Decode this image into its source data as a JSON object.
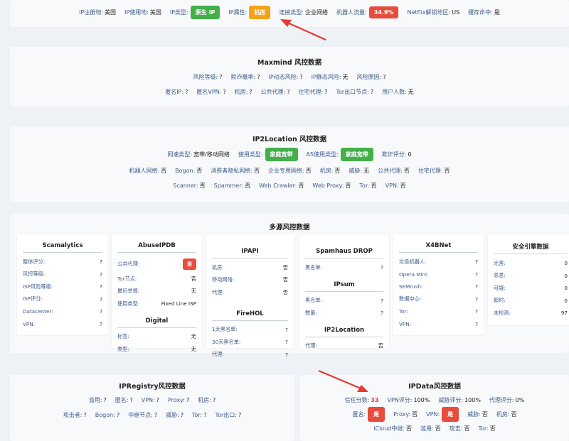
{
  "top": {
    "items": [
      {
        "k": "IP注册地:",
        "v": "美国"
      },
      {
        "k": "IP使用地:",
        "v": "美国"
      },
      {
        "k": "IP类型:",
        "badge": "原生 IP",
        "color": "#43b04a"
      },
      {
        "k": "IP属性:",
        "badge": "机房",
        "color": "#f5a21b"
      },
      {
        "k": "连接类型:",
        "v": "企业网络"
      },
      {
        "k": "机器人流量:",
        "badge": "34.9%",
        "color": "#e74c3c"
      },
      {
        "k": "Netflix解锁地区:",
        "v": "US"
      },
      {
        "k": "缓存命中:",
        "v": "是"
      }
    ]
  },
  "maxmind": {
    "title": "Maxmind 风控数据",
    "row1": [
      {
        "k": "风险等级:",
        "v": "?"
      },
      {
        "k": "欺诈概率:",
        "v": "?"
      },
      {
        "k": "IP动态风险:",
        "v": "?"
      },
      {
        "k": "IP静态风险:",
        "v": "无"
      },
      {
        "k": "风险原因:",
        "v": "?"
      }
    ],
    "row2": [
      {
        "k": "匿名IP:",
        "v": "?"
      },
      {
        "k": "匿名VPN:",
        "v": "?"
      },
      {
        "k": "机房:",
        "v": "?"
      },
      {
        "k": "公共代理:",
        "v": "?"
      },
      {
        "k": "住宅代理:",
        "v": "?"
      },
      {
        "k": "Tor出口节点:",
        "v": "?"
      },
      {
        "k": "用户人数:",
        "v": "无"
      }
    ]
  },
  "ip2location": {
    "title": "IP2Location 风控数据",
    "row1": [
      {
        "k": "网速类型:",
        "v": "宽带/移动网络"
      },
      {
        "k": "使用类型:",
        "badge": "家庭宽带",
        "color": "#43b04a"
      },
      {
        "k": "AS使用类型:",
        "badge": "家庭宽带",
        "color": "#43b04a"
      },
      {
        "k": "欺诈评分:",
        "v": "0"
      }
    ],
    "row2": [
      {
        "k": "机器人网络:",
        "v": "否"
      },
      {
        "k": "Bogon:",
        "v": "否"
      },
      {
        "k": "消费者隐私网络:",
        "v": "否"
      },
      {
        "k": "企业专用网络:",
        "v": "否"
      },
      {
        "k": "机房:",
        "v": "否"
      },
      {
        "k": "威胁:",
        "v": "无"
      },
      {
        "k": "公共代理:",
        "v": "否"
      },
      {
        "k": "住宅代理:",
        "v": "否"
      }
    ],
    "row3": [
      {
        "k": "Scanner:",
        "v": "否"
      },
      {
        "k": "Spammer:",
        "v": "否"
      },
      {
        "k": "Web Crawler:",
        "v": "否"
      },
      {
        "k": "Web Proxy:",
        "v": "否"
      },
      {
        "k": "Tor:",
        "v": "否"
      },
      {
        "k": "VPN:",
        "v": "否"
      }
    ]
  },
  "multi": {
    "title": "多源风控数据",
    "scamalytics": {
      "title": "Scamalytics",
      "rows": [
        {
          "k": "整体评分:",
          "v": "?"
        },
        {
          "k": "风控等级:",
          "v": "?"
        },
        {
          "k": "ISP风险等级:",
          "v": "?"
        },
        {
          "k": "ISP评分:",
          "v": "?"
        },
        {
          "k": "Datacenter:",
          "v": "?"
        },
        {
          "k": "VPN:",
          "v": "?"
        }
      ]
    },
    "abuseipdb": {
      "title": "AbuseIPDB",
      "rows": [
        {
          "k": "公共代理:",
          "badge": "是"
        },
        {
          "k": "Tor节点:",
          "v": "否"
        },
        {
          "k": "最后举报:",
          "v": "无"
        },
        {
          "k": "使用类型:",
          "v": "Fixed Line ISP"
        }
      ]
    },
    "digital": {
      "title": "Digital",
      "rows": [
        {
          "k": "标签:",
          "v": "无"
        },
        {
          "k": "类型:",
          "v": "无"
        }
      ]
    },
    "ipapi": {
      "title": "IPAPI",
      "rows": [
        {
          "k": "机房:",
          "v": "否"
        },
        {
          "k": "移动网络:",
          "v": "否"
        },
        {
          "k": "代理:",
          "v": "否"
        }
      ]
    },
    "firehol": {
      "title": "FireHOL",
      "rows": [
        {
          "k": "1天黑名单:",
          "v": "?"
        },
        {
          "k": "30天黑名单:",
          "v": "?"
        },
        {
          "k": "代理:",
          "v": "?"
        }
      ]
    },
    "spamhaus": {
      "title": "Spamhaus DROP",
      "rows": [
        {
          "k": "黑名单:",
          "v": "?"
        }
      ]
    },
    "ipsum": {
      "title": "IPsum",
      "rows": [
        {
          "k": "黑名单:",
          "v": "?"
        },
        {
          "k": "数量:",
          "v": "?"
        }
      ]
    },
    "ip2loc_card": {
      "title": "IP2Location",
      "rows": [
        {
          "k": "代理:",
          "v": "否"
        }
      ]
    },
    "x4bnet": {
      "title": "X4BNet",
      "rows": [
        {
          "k": "垃圾机器人:",
          "v": "?"
        },
        {
          "k": "Opera Mini:",
          "v": "?"
        },
        {
          "k": "SEMrush:",
          "v": "?"
        },
        {
          "k": "数据中心:",
          "v": "?"
        },
        {
          "k": "Tor:",
          "v": "?"
        },
        {
          "k": "VPN:",
          "v": "?"
        }
      ]
    },
    "engine": {
      "title": "安全引擎数据",
      "rows": [
        {
          "k": "无害:",
          "v": "0"
        },
        {
          "k": "恶意:",
          "v": "0"
        },
        {
          "k": "可疑:",
          "v": "0"
        },
        {
          "k": "超时:",
          "v": "0"
        },
        {
          "k": "未检测:",
          "v": "97"
        }
      ]
    }
  },
  "ipregistry": {
    "title": "IPRegistry风控数据",
    "row1": [
      {
        "k": "滥用:",
        "v": "?"
      },
      {
        "k": "匿名:",
        "v": "?"
      },
      {
        "k": "VPN:",
        "v": "?"
      },
      {
        "k": "Proxy:",
        "v": "?"
      },
      {
        "k": "机房:",
        "v": "?"
      }
    ],
    "row2": [
      {
        "k": "攻击者:",
        "v": "?"
      },
      {
        "k": "Bogon:",
        "v": "?"
      },
      {
        "k": "中继节点:",
        "v": "?"
      },
      {
        "k": "威胁:",
        "v": "?"
      },
      {
        "k": "Tor:",
        "v": "?"
      },
      {
        "k": "Tor出口:",
        "v": "?"
      }
    ]
  },
  "ipdata": {
    "title": "IPData风控数据",
    "row1": [
      {
        "k": "信任分数:",
        "v": "33",
        "red": true
      },
      {
        "k": "VPN评分:",
        "v": "100%"
      },
      {
        "k": "威胁评分:",
        "v": "100%"
      },
      {
        "k": "代理评分:",
        "v": "0%"
      }
    ],
    "row2": [
      {
        "k": "匿名:",
        "badge": "是",
        "color": "#e74c3c"
      },
      {
        "k": "Proxy:",
        "v": "否"
      },
      {
        "k": "VPN:",
        "badge": "是",
        "color": "#e74c3c"
      },
      {
        "k": "威胁:",
        "v": "否"
      },
      {
        "k": "机房:",
        "v": "否"
      }
    ],
    "row3": [
      {
        "k": "iCloud中继:",
        "v": "否"
      },
      {
        "k": "滥用:",
        "v": "否"
      },
      {
        "k": "攻击:",
        "v": "否"
      },
      {
        "k": "Tor:",
        "v": "否"
      }
    ]
  }
}
